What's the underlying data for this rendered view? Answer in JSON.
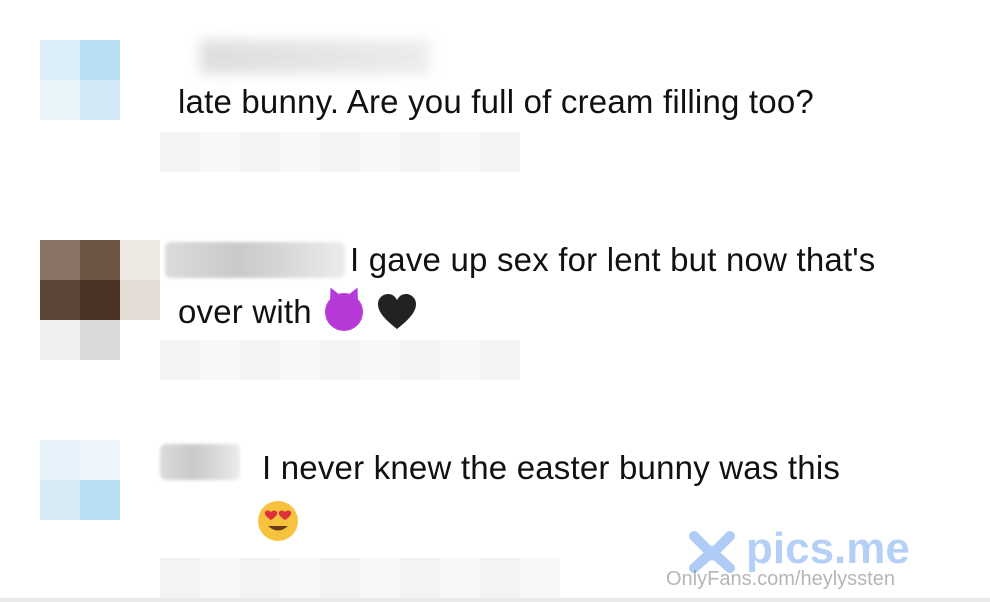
{
  "comments": [
    {
      "text": "late bunny. Are you full of cream filling too?",
      "emojis": []
    },
    {
      "text_line1": "I gave up sex for lent but now that's",
      "text_line2": "over with",
      "emojis": [
        "smiling-face-with-horns",
        "black-heart"
      ]
    },
    {
      "text": "I never knew the easter bunny was this",
      "emojis": [
        "smiling-face-with-heart-eyes"
      ]
    }
  ],
  "watermark": {
    "brand": "pics.me",
    "source": "OnlyFans.com/heylyssten"
  },
  "colors": {
    "text": "#111111",
    "background": "#ffffff",
    "devil": "#b53ad8",
    "watermark": "#78aaf0"
  }
}
